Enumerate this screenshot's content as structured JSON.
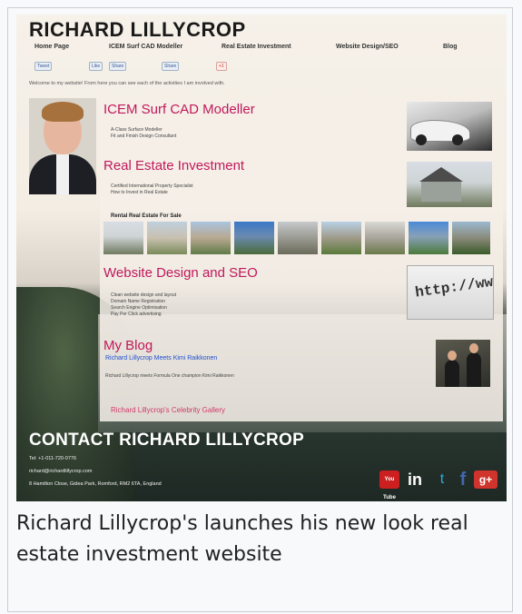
{
  "site": {
    "title": "RICHARD LILLYCROP",
    "nav": [
      "Home Page",
      "ICEM Surf CAD Modeller",
      "Real Estate Investment",
      "Website Design/SEO",
      "Blog"
    ],
    "share_buttons": [
      "Tweet",
      "Like",
      "Share",
      "Share",
      "+1"
    ],
    "welcome": "Welcome to my website! From here you can see each of the activities I am involved with."
  },
  "sections": {
    "icem": {
      "title": "ICEM Surf CAD Modeller",
      "lines": [
        "A-Class Surface Modeller",
        "Fit and Finish Design Consultant"
      ]
    },
    "real_estate": {
      "title": "Real Estate Investment",
      "lines": [
        "Certified International Property Specialist",
        "How to Invest in Real Estate"
      ]
    },
    "rental": {
      "label": "Rental Real Estate For Sale",
      "photo_count": 9
    },
    "website": {
      "title": "Website Design and SEO",
      "image_text": "http://www",
      "lines": [
        "Clean website design and layout",
        "Domain Name Registration",
        "Search Engine Optimisation",
        "Pay Per Click advertising"
      ]
    },
    "blog": {
      "title": "My Blog",
      "post_title": "Richard Lillycrop Meets Kimi Raikkonen",
      "post_text": "Richard Lillycrop meets Formula One champion Kimi Raikkonen",
      "gallery": "Richard Lillycrop's Celebrity Gallery"
    }
  },
  "contact": {
    "title": "CONTACT RICHARD LILLYCROP",
    "tel": "Tel: +1-011-720-0776",
    "email": "richard@richardlillycrop.com",
    "address": "8 Hamilton Close, Gidea Park, Romford, RM2 6TA, England"
  },
  "social": {
    "youtube": "You Tube",
    "linkedin": "in",
    "twitter": "t",
    "facebook": "f",
    "googleplus": "g+"
  },
  "caption": "Richard Lillycrop's launches his new look real estate investment website"
}
